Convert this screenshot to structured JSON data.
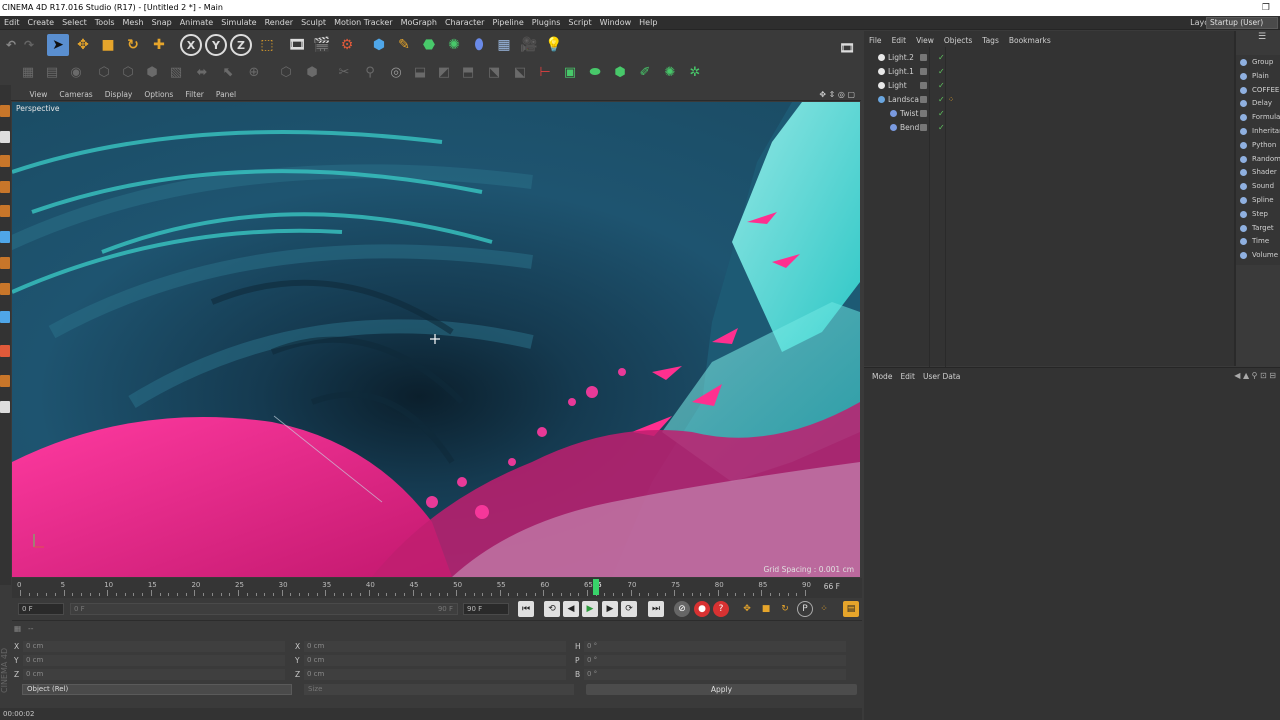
{
  "window": {
    "title": "CINEMA 4D R17.016 Studio (R17) - [Untitled 2 *] - Main",
    "restore_icon": "restore-icon"
  },
  "menu": {
    "items": [
      "Edit",
      "Create",
      "Select",
      "Tools",
      "Mesh",
      "Snap",
      "Animate",
      "Simulate",
      "Render",
      "Sculpt",
      "Motion Tracker",
      "MoGraph",
      "Character",
      "Pipeline",
      "Plugins",
      "Script",
      "Window",
      "Help"
    ],
    "layout_label": "Layout:",
    "layout_value": "Startup (User)"
  },
  "viewport": {
    "menu": [
      "View",
      "Cameras",
      "Display",
      "Options",
      "Filter",
      "Panel"
    ],
    "label": "Perspective",
    "grid_spacing": "Grid Spacing : 0.001 cm"
  },
  "timeline": {
    "ticks": [
      "0",
      "5",
      "10",
      "15",
      "20",
      "25",
      "30",
      "35",
      "40",
      "45",
      "50",
      "55",
      "60",
      "65",
      "66",
      "70",
      "75",
      "80",
      "85",
      "90"
    ],
    "current_frame": 66,
    "end_label": "66 F",
    "max_frame": 90
  },
  "transport": {
    "start_field": "0 F",
    "range_start": "0 F",
    "range_end": "90 F",
    "end_field": "90 F"
  },
  "coords": {
    "col1": [
      {
        "axis": "X",
        "value": "0 cm"
      },
      {
        "axis": "Y",
        "value": "0 cm"
      },
      {
        "axis": "Z",
        "value": "0 cm"
      }
    ],
    "col2": [
      {
        "axis": "X",
        "value": "0 cm"
      },
      {
        "axis": "Y",
        "value": "0 cm"
      },
      {
        "axis": "Z",
        "value": "0 cm"
      }
    ],
    "col3": [
      {
        "axis": "H",
        "value": "0 °"
      },
      {
        "axis": "P",
        "value": "0 °"
      },
      {
        "axis": "B",
        "value": "0 °"
      }
    ],
    "mode_select": "Object (Rel)",
    "size_select": "Size",
    "apply": "Apply",
    "header": "--"
  },
  "status": {
    "time": "00:00:02"
  },
  "brand": "CINEMA 4D",
  "object_manager": {
    "menu": [
      "File",
      "Edit",
      "View",
      "Objects",
      "Tags",
      "Bookmarks"
    ],
    "objects": [
      {
        "name": "Light.2",
        "color": "#e8e8e8"
      },
      {
        "name": "Light.1",
        "color": "#e8e8e8"
      },
      {
        "name": "Light",
        "color": "#e8e8e8"
      },
      {
        "name": "Landsca",
        "color": "#6aa6e0"
      },
      {
        "name": "Twist",
        "color": "#7a9ae0"
      },
      {
        "name": "Bend",
        "color": "#7a9ae0"
      }
    ]
  },
  "attribute_manager": {
    "menu": [
      "Mode",
      "Edit",
      "User Data"
    ]
  },
  "side_palette": {
    "items": [
      "Group",
      "Plain",
      "COFFEE",
      "Delay",
      "Formula",
      "Inheritance",
      "Python",
      "Random",
      "Shader",
      "Sound",
      "Spline",
      "Step",
      "Target",
      "Time",
      "Volume"
    ]
  }
}
